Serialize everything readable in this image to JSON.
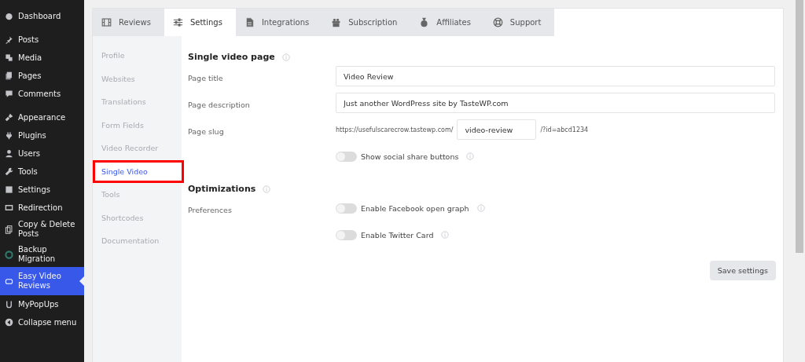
{
  "admin_menu": {
    "groups": [
      [
        {
          "label": "Dashboard",
          "selected": false
        }
      ],
      [
        {
          "label": "Posts",
          "selected": false
        },
        {
          "label": "Media",
          "selected": false
        },
        {
          "label": "Pages",
          "selected": false
        },
        {
          "label": "Comments",
          "selected": false
        }
      ],
      [
        {
          "label": "Appearance",
          "selected": false
        },
        {
          "label": "Plugins",
          "selected": false
        },
        {
          "label": "Users",
          "selected": false
        },
        {
          "label": "Tools",
          "selected": false
        },
        {
          "label": "Settings",
          "selected": false
        },
        {
          "label": "Redirection",
          "selected": false
        },
        {
          "label": "Copy & Delete Posts",
          "selected": false
        },
        {
          "label": "Backup Migration",
          "selected": false
        },
        {
          "label": "Easy Video Reviews",
          "selected": true
        },
        {
          "label": "MyPopUps",
          "selected": false
        },
        {
          "label": "Collapse menu",
          "selected": false
        }
      ]
    ]
  },
  "tabs": [
    {
      "label": "Reviews",
      "selected": false
    },
    {
      "label": "Settings",
      "selected": true
    },
    {
      "label": "Integrations",
      "selected": false
    },
    {
      "label": "Subscription",
      "selected": false
    },
    {
      "label": "Affiliates",
      "selected": false
    },
    {
      "label": "Support",
      "selected": false
    }
  ],
  "sub_nav": [
    {
      "label": "Profile",
      "selected": false,
      "highlighted": false
    },
    {
      "label": "Websites",
      "selected": false,
      "highlighted": false
    },
    {
      "label": "Translations",
      "selected": false,
      "highlighted": false
    },
    {
      "label": "Form Fields",
      "selected": false,
      "highlighted": false
    },
    {
      "label": "Video Recorder",
      "selected": false,
      "highlighted": false
    },
    {
      "label": "Single Video",
      "selected": true,
      "highlighted": true
    },
    {
      "label": "Tools",
      "selected": false,
      "highlighted": false
    },
    {
      "label": "Shortcodes",
      "selected": false,
      "highlighted": false
    },
    {
      "label": "Documentation",
      "selected": false,
      "highlighted": false
    }
  ],
  "sections": [
    {
      "title": "Single video page",
      "rows": [
        {
          "kind": "text",
          "label": "Page title",
          "value": "Video Review"
        },
        {
          "kind": "text",
          "label": "Page description",
          "value": "Just another WordPress site by TasteWP.com"
        },
        {
          "kind": "slug",
          "label": "Page slug",
          "prefix": "https://usefulscarecrow.tastewp.com/",
          "value": "video-review",
          "suffix": "/?id=abcd1234"
        },
        {
          "kind": "toggle",
          "text": "Show social share buttons",
          "on": false
        }
      ]
    },
    {
      "title": "Optimizations",
      "rows": [
        {
          "kind": "toggle",
          "label": "Preferences",
          "text": "Enable Facebook open graph",
          "on": false
        },
        {
          "kind": "toggle",
          "text": "Enable Twitter Card",
          "on": false
        }
      ]
    }
  ],
  "save_button": "Save settings"
}
